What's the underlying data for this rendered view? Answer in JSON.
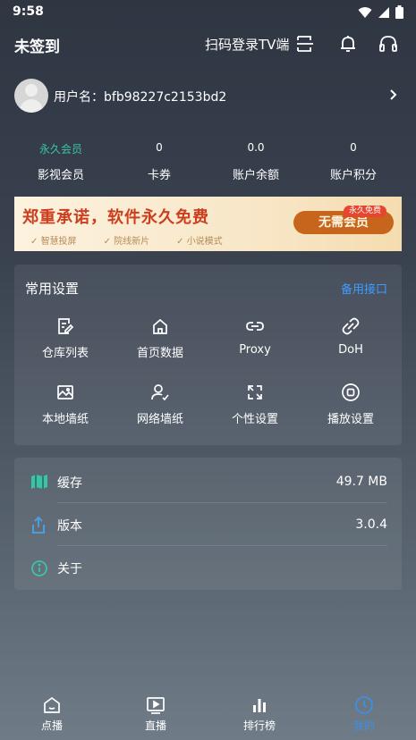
{
  "status_bar": {
    "time": "9:58"
  },
  "header": {
    "title": "未签到",
    "scan_login": "扫码登录TV端"
  },
  "user": {
    "username": "用户名：bfb98227c2153bd2"
  },
  "stats": [
    {
      "value": "永久会员",
      "label": "影视会员"
    },
    {
      "value": "0",
      "label": "卡券"
    },
    {
      "value": "0.0",
      "label": "账户余额"
    },
    {
      "value": "0",
      "label": "账户积分"
    }
  ],
  "banner": {
    "headline": "郑重承诺，软件永久免费",
    "features": [
      "智慧投屏",
      "院线新片",
      "小说模式"
    ],
    "pill": "无需会员",
    "tag": "永久免费"
  },
  "common_settings": {
    "title": "常用设置",
    "backup_link": "备用接口",
    "items": [
      {
        "label": "仓库列表",
        "icon": "file-edit-icon"
      },
      {
        "label": "首页数据",
        "icon": "home-icon"
      },
      {
        "label": "Proxy",
        "icon": "link-icon"
      },
      {
        "label": "DoH",
        "icon": "chain-icon"
      },
      {
        "label": "本地墙纸",
        "icon": "image-icon"
      },
      {
        "label": "网络墙纸",
        "icon": "user-check-icon"
      },
      {
        "label": "个性设置",
        "icon": "expand-icon"
      },
      {
        "label": "播放设置",
        "icon": "play-circle-icon"
      }
    ]
  },
  "info": {
    "rows": [
      {
        "label": "缓存",
        "value": "49.7 MB",
        "icon": "map-icon"
      },
      {
        "label": "版本",
        "value": "3.0.4",
        "icon": "share-icon"
      },
      {
        "label": "关于",
        "value": "",
        "icon": "info-circle-icon"
      }
    ]
  },
  "nav": {
    "items": [
      {
        "label": "点播",
        "icon": "home-smile-icon"
      },
      {
        "label": "直播",
        "icon": "tv-play-icon"
      },
      {
        "label": "排行榜",
        "icon": "bar-chart-icon"
      },
      {
        "label": "我的",
        "icon": "clock-icon"
      }
    ],
    "active_index": 3
  },
  "colors": {
    "accent": "#3d8fe6",
    "vip_green": "#39c5a5",
    "banner_red": "#cc3e1e"
  }
}
